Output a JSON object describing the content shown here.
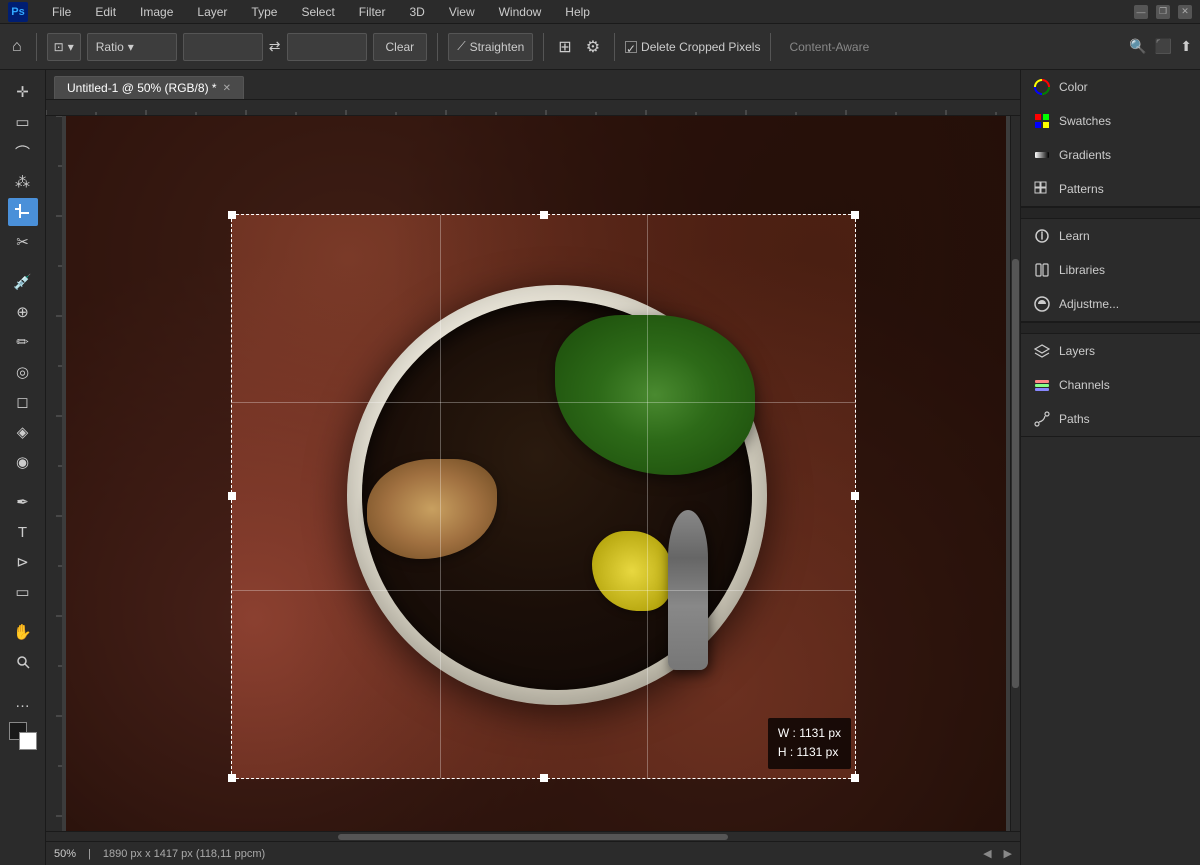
{
  "app": {
    "name": "Ps",
    "title": "Adobe Photoshop"
  },
  "menu": {
    "items": [
      "File",
      "Edit",
      "Image",
      "Layer",
      "Type",
      "Select",
      "Filter",
      "3D",
      "View",
      "Window",
      "Help"
    ]
  },
  "window_controls": {
    "minimize": "—",
    "restore": "❐",
    "close": "✕"
  },
  "toolbar": {
    "crop_mode": "⊡",
    "ratio_label": "Ratio",
    "ratio_dropdown": "▾",
    "input1_value": "",
    "input2_value": "",
    "swap_icon": "⇄",
    "clear_label": "Clear",
    "straighten_label": "Straighten",
    "grid_icon": "⊞",
    "gear_icon": "⚙",
    "delete_cropped_label": "Delete Cropped Pixels",
    "content_aware_label": "Content-Aware",
    "search_icon": "🔍",
    "expand_icon": "⤢",
    "share_icon": "⤴"
  },
  "tab": {
    "title": "Untitled-1 @ 50% (RGB/8) *",
    "close": "✕"
  },
  "tools": {
    "move": "✛",
    "selection_rect": "▭",
    "lasso": "⌒",
    "magic_wand": "✱",
    "crop": "⊡",
    "slice": "⋈",
    "eyedropper": "✒",
    "healing": "⊕",
    "brush": "/",
    "clone": "◎",
    "eraser": "◻",
    "gradient": "◈",
    "blur": "◉",
    "pen": "✎",
    "text": "T",
    "path_select": "⊳",
    "shape": "▭",
    "hand": "✋",
    "zoom": "🔍",
    "more": "…"
  },
  "canvas": {
    "bg_color": "#3c3c3c"
  },
  "crop": {
    "width_px": "1131",
    "height_px": "1131",
    "dim_label_w": "W : 1131 px",
    "dim_label_h": "H : 1131 px"
  },
  "right_panel": {
    "sections": [
      {
        "items": [
          {
            "label": "Color",
            "icon": "color"
          },
          {
            "label": "Swatches",
            "icon": "swatches"
          },
          {
            "label": "Gradients",
            "icon": "gradients"
          },
          {
            "label": "Patterns",
            "icon": "patterns"
          }
        ]
      },
      {
        "items": [
          {
            "label": "Learn",
            "icon": "learn"
          },
          {
            "label": "Libraries",
            "icon": "libraries"
          },
          {
            "label": "Adjustme...",
            "icon": "adjustments"
          }
        ]
      },
      {
        "items": [
          {
            "label": "Layers",
            "icon": "layers"
          },
          {
            "label": "Channels",
            "icon": "channels"
          },
          {
            "label": "Paths",
            "icon": "paths"
          }
        ]
      }
    ]
  },
  "status_bar": {
    "zoom": "50%",
    "info": "1890 px x 1417 px (118,11 ppcm)"
  }
}
